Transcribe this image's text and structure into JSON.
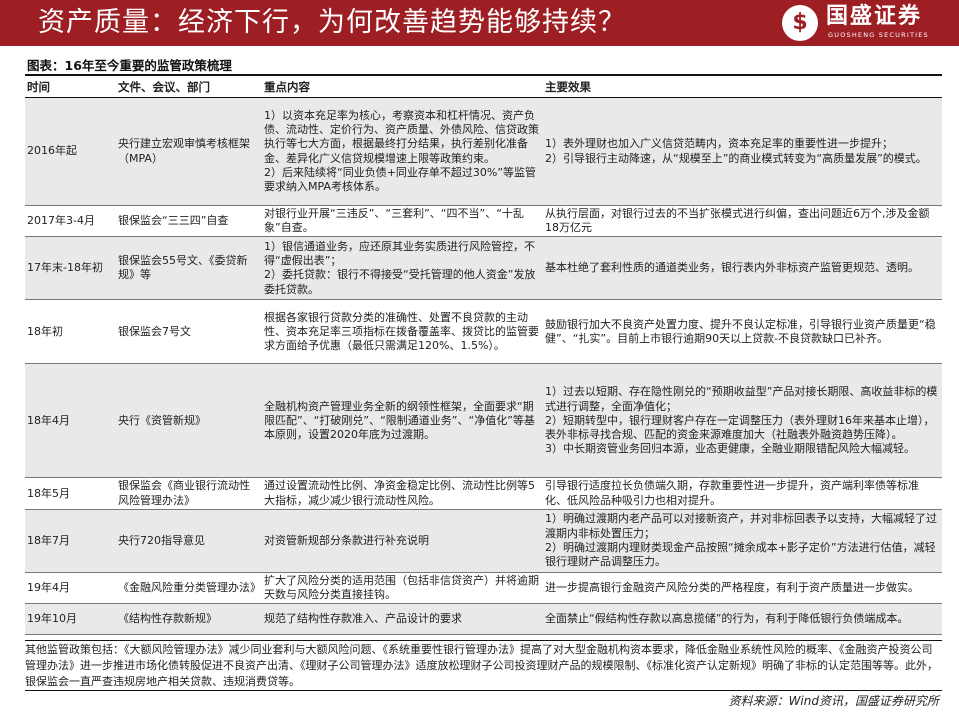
{
  "header": {
    "title": "资产质量：经济下行，为何改善趋势能够持续？",
    "logo_name": "国盛证券",
    "logo_en": "GUOSHENG SECURITIES",
    "logo_icon": "guosheng-logo-icon",
    "brand_color": "#9d1f23"
  },
  "figure": {
    "title": "图表：16年至今重要的监管政策梳理"
  },
  "table": {
    "columns": [
      "时间",
      "文件、会议、部门",
      "重点内容",
      "主要效果"
    ],
    "rows": [
      {
        "time": "2016年起",
        "doc": "央行建立宏观审慎考核框架（MPA）",
        "content": "1）以资本充足率为核心，考察资本和杠杆情况、资产负债、流动性、定价行为、资产质量、外债风险、信贷政策执行等七大方面，根据最终打分结果，执行差别化准备金、差异化广义信贷规模增速上限等政策约束。\n2）后来陆续将“同业负债+同业存单不超过30%”等监管要求纳入MPA考核体系。",
        "effect": "1）表外理财也加入广义信贷范畴内，资本充足率的重要性进一步提升；\n2）引导银行主动降速，从“规模至上”的商业模式转变为“高质量发展”的模式。"
      },
      {
        "time": "2017年3-4月",
        "doc": "银保监会“三三四”自查",
        "content": "对银行业开展“三违反”、“三套利”、“四不当”、“十乱象”自查。",
        "effect": "从执行层面，对银行过去的不当扩张模式进行纠偏，查出问题近6万个,涉及金额18万亿元"
      },
      {
        "time": "17年末-18年初",
        "doc": "银保监会55号文、《委贷新规》等",
        "content": "1）银信通道业务，应还原其业务实质进行风险管控，不得“虚假出表”；\n2）委托贷款：银行不得接受“受托管理的他人资金”发放委托贷款。",
        "effect": "基本杜绝了套利性质的通道类业务，银行表内外非标资产监管更规范、透明。"
      },
      {
        "time": "18年初",
        "doc": "银保监会7号文",
        "content": "根据各家银行贷款分类的准确性、处置不良贷款的主动性、资本充足率三项指标在拨备覆盖率、拨贷比的监管要求方面给予优惠（最低只需满足120%、1.5%）。",
        "effect": "鼓励银行加大不良资产处置力度、提升不良认定标准，引导银行业资产质量更“稳健”、“扎实”。目前上市银行逾期90天以上贷款-不良贷款缺口已补齐。"
      },
      {
        "time": "18年4月",
        "doc": "央行《资管新规》",
        "content": "全融机构资产管理业务全新的纲领性框架，全面要求“期限匹配”、“打破刚兑”、“限制通道业务”、“净值化”等基本原则，设置2020年底为过渡期。",
        "effect": "1）过去以短期、存在隐性刚兑的“预期收益型”产品对接长期限、高收益非标的模式进行调整，全面净值化；\n2）短期转型中，银行理财客户存在一定调整压力（表外理财16年来基本止增），表外非标寻找合规、匹配的资金来源难度加大（社融表外融资趋势压降）。\n3）中长期资管业务回归本源，业态更健康，全融业期限错配风险大幅减轻。"
      },
      {
        "time": "18年5月",
        "doc": "银保监会《商业银行流动性风险管理办法》",
        "content": "通过设置流动性比例、净资金稳定比例、流动性比例等5大指标，减少减少银行流动性风险。",
        "effect": "引导银行适度拉长负债端久期，存款重要性进一步提升，资产端利率债等标准化、低风险品种吸引力也相对提升。"
      },
      {
        "time": "18年7月",
        "doc": "央行720指导意见",
        "content": "对资管新规部分条款进行补充说明",
        "effect": "1）明确过渡期内老产品可以对接新资产，并对非标回表予以支持，大幅减轻了过渡期内非标处置压力；\n2）明确过渡期内理财类现金产品按照“摊余成本+影子定价”方法进行估值，减轻银行理财产品调整压力。"
      },
      {
        "time": "19年4月",
        "doc": "《金融风险重分类管理办法》",
        "content": "扩大了风险分类的适用范围（包括非信贷资产）并将逾期天数与风险分类直接挂钩。",
        "effect": "进一步提高银行金融资产风险分类的严格程度，有利于资产质量进一步做实。"
      },
      {
        "time": "19年10月",
        "doc": "《结构性存款新规》",
        "content": "规范了结构性存款准入、产品设计的要求",
        "effect": "全面禁止“假结构性存款以高息揽储”的行为，有利于降低银行负债端成本。"
      }
    ]
  },
  "footnote": "其他监管政策包括：《大额风险管理办法》减少同业套利与大额风险问题、《系统重要性银行管理办法》提高了对大型金融机构资本要求，降低金融业系统性风险的概率、《金融资产投资公司管理办法》进一步推进市场化债转股促进不良资产出清、《理财子公司管理办法》适度放松理财子公司投资理财产品的规模限制、《标准化资产认定新规》明确了非标的认定范围等等。此外，银保监会一直严查违规房地产相关贷款、违规消费贷等。",
  "source": "资料来源：Wind资讯，国盛证券研究所"
}
